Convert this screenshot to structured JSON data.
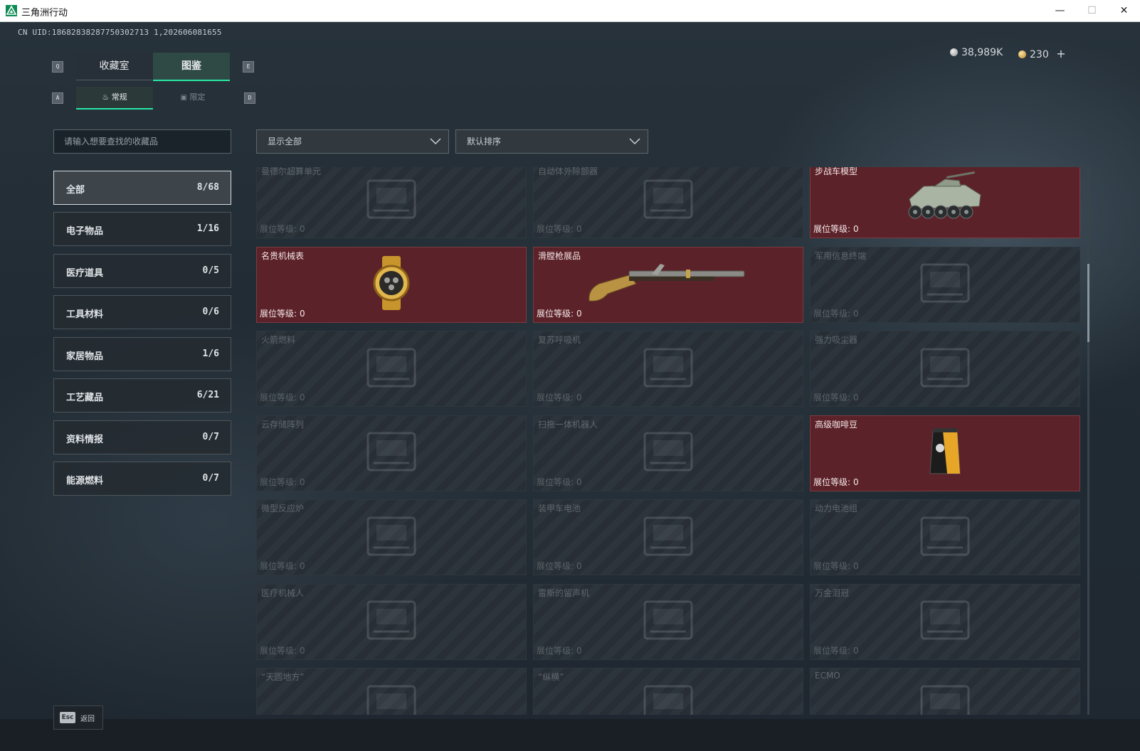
{
  "window": {
    "title": "三角洲行动",
    "minimize": "—",
    "maximize": "☐",
    "close": "✕"
  },
  "uid_text": "CN UID:18682838287750302713 1,202606081655",
  "currency": {
    "silver": "38,989K",
    "gold": "230",
    "add": "+"
  },
  "key_hints": {
    "q": "Q",
    "e": "E",
    "a": "A",
    "d": "D"
  },
  "tabs": [
    {
      "label": "收藏室"
    },
    {
      "label": "图鉴"
    }
  ],
  "subtabs": [
    {
      "label": "常规"
    },
    {
      "label": "限定"
    }
  ],
  "search": {
    "placeholder": "请输入想要查找的收藏品"
  },
  "filters": {
    "show": "显示全部",
    "sort": "默认排序"
  },
  "categories": [
    {
      "label": "全部",
      "count": "8/68"
    },
    {
      "label": "电子物品",
      "count": "1/16"
    },
    {
      "label": "医疗道具",
      "count": "0/5"
    },
    {
      "label": "工具材料",
      "count": "0/6"
    },
    {
      "label": "家居物品",
      "count": "1/6"
    },
    {
      "label": "工艺藏品",
      "count": "6/21"
    },
    {
      "label": "资料情报",
      "count": "0/7"
    },
    {
      "label": "能源燃料",
      "count": "0/7"
    }
  ],
  "level_prefix": "展位等级:",
  "items": [
    {
      "name": "曼德尔超算单元",
      "level": "0",
      "owned": false,
      "icon": "supercomputer-icon"
    },
    {
      "name": "自动体外除颤器",
      "level": "0",
      "owned": false,
      "icon": "defibrillator-icon"
    },
    {
      "name": "步战车模型",
      "level": "0",
      "owned": true,
      "icon": "ifv-model-icon"
    },
    {
      "name": "名贵机械表",
      "level": "0",
      "owned": true,
      "icon": "watch-icon"
    },
    {
      "name": "滑膛枪展品",
      "level": "0",
      "owned": true,
      "icon": "musket-icon"
    },
    {
      "name": "军用信息终端",
      "level": "0",
      "owned": false,
      "icon": "terminal-icon"
    },
    {
      "name": "火箭燃料",
      "level": "0",
      "owned": false,
      "icon": "fuel-icon"
    },
    {
      "name": "复苏呼吸机",
      "level": "0",
      "owned": false,
      "icon": "ventilator-icon"
    },
    {
      "name": "强力吸尘器",
      "level": "0",
      "owned": false,
      "icon": "vacuum-icon"
    },
    {
      "name": "云存储阵列",
      "level": "0",
      "owned": false,
      "icon": "storage-array-icon"
    },
    {
      "name": "扫拖一体机器人",
      "level": "0",
      "owned": false,
      "icon": "robot-vacuum-icon"
    },
    {
      "name": "高级咖啡豆",
      "level": "0",
      "owned": true,
      "icon": "coffee-bag-icon"
    },
    {
      "name": "微型反应炉",
      "level": "0",
      "owned": false,
      "icon": "reactor-icon"
    },
    {
      "name": "装甲车电池",
      "level": "0",
      "owned": false,
      "icon": "battery-icon"
    },
    {
      "name": "动力电池组",
      "level": "0",
      "owned": false,
      "icon": "battery-pack-icon"
    },
    {
      "name": "医疗机械人",
      "level": "0",
      "owned": false,
      "icon": "medical-robot-icon"
    },
    {
      "name": "雷斯的留声机",
      "level": "0",
      "owned": false,
      "icon": "gramophone-icon"
    },
    {
      "name": "万金泪冠",
      "level": "0",
      "owned": false,
      "icon": "crown-icon"
    },
    {
      "name": "“天圆地方”",
      "level": "",
      "owned": false,
      "icon": "artifact-icon"
    },
    {
      "name": "“纵横”",
      "level": "",
      "owned": false,
      "icon": "artifact-icon"
    },
    {
      "name": "ECMO",
      "level": "",
      "owned": false,
      "icon": "ecmo-icon"
    }
  ],
  "footer": {
    "esc_key": "Esc",
    "esc_label": "返回"
  },
  "colors": {
    "accent": "#28e8a6",
    "owned_card": "#5c2229",
    "locked_card": "#283037"
  }
}
